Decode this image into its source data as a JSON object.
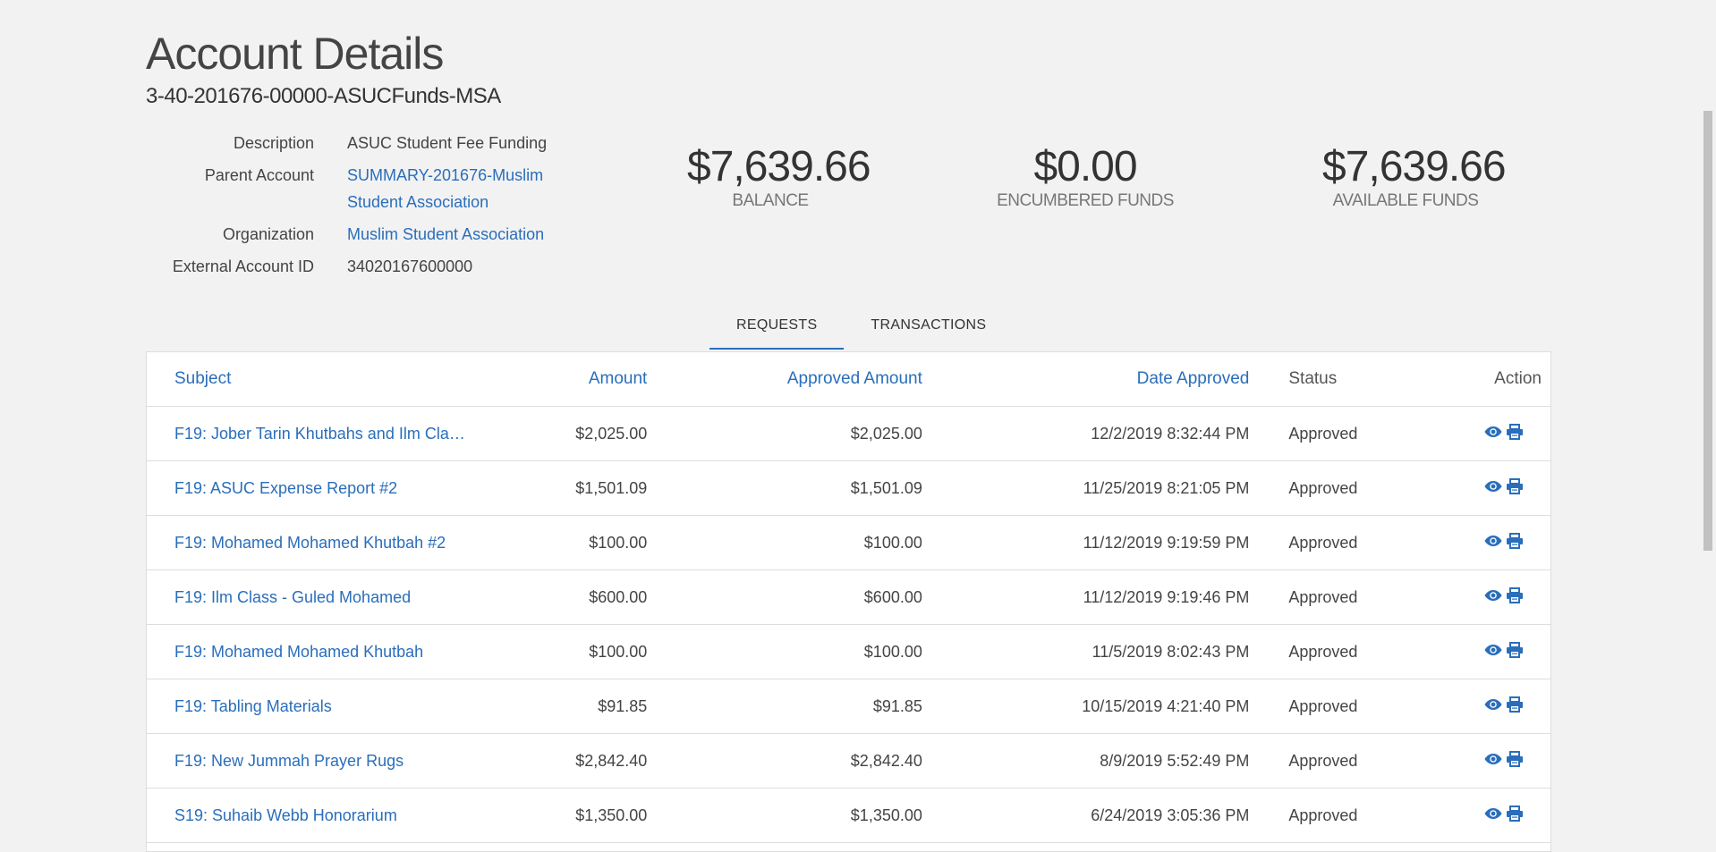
{
  "page": {
    "title": "Account Details",
    "account_code": "3-40-201676-00000-ASUCFunds-MSA"
  },
  "details": {
    "description_label": "Description",
    "description_value": "ASUC Student Fee Funding",
    "parent_label": "Parent Account",
    "parent_value": "SUMMARY-201676-Muslim Student Association",
    "organization_label": "Organization",
    "organization_value": "Muslim Student Association",
    "external_label": "External Account ID",
    "external_value": "34020167600000"
  },
  "stats": {
    "balance_value": "$7,639.66",
    "balance_label": "BALANCE",
    "encumbered_value": "$0.00",
    "encumbered_label": "ENCUMBERED FUNDS",
    "available_value": "$7,639.66",
    "available_label": "AVAILABLE FUNDS"
  },
  "tabs": [
    {
      "label": "REQUESTS",
      "active": true
    },
    {
      "label": "TRANSACTIONS",
      "active": false
    }
  ],
  "table": {
    "headers": {
      "subject": "Subject",
      "amount": "Amount",
      "approved_amount": "Approved Amount",
      "date_approved": "Date Approved",
      "status": "Status",
      "action": "Action"
    },
    "rows": [
      {
        "subject": "F19: Jober Tarin Khutbahs and Ilm Cla…",
        "amount": "$2,025.00",
        "approved": "$2,025.00",
        "date": "12/2/2019 8:32:44 PM",
        "status": "Approved"
      },
      {
        "subject": "F19: ASUC Expense Report #2",
        "amount": "$1,501.09",
        "approved": "$1,501.09",
        "date": "11/25/2019 8:21:05 PM",
        "status": "Approved"
      },
      {
        "subject": "F19: Mohamed Mohamed Khutbah #2",
        "amount": "$100.00",
        "approved": "$100.00",
        "date": "11/12/2019 9:19:59 PM",
        "status": "Approved"
      },
      {
        "subject": "F19: Ilm Class - Guled Mohamed",
        "amount": "$600.00",
        "approved": "$600.00",
        "date": "11/12/2019 9:19:46 PM",
        "status": "Approved"
      },
      {
        "subject": "F19: Mohamed Mohamed Khutbah",
        "amount": "$100.00",
        "approved": "$100.00",
        "date": "11/5/2019 8:02:43 PM",
        "status": "Approved"
      },
      {
        "subject": "F19: Tabling Materials",
        "amount": "$91.85",
        "approved": "$91.85",
        "date": "10/15/2019 4:21:40 PM",
        "status": "Approved"
      },
      {
        "subject": "F19: New Jummah Prayer Rugs",
        "amount": "$2,842.40",
        "approved": "$2,842.40",
        "date": "8/9/2019 5:52:49 PM",
        "status": "Approved"
      },
      {
        "subject": "S19: Suhaib Webb Honorarium",
        "amount": "$1,350.00",
        "approved": "$1,350.00",
        "date": "6/24/2019 3:05:36 PM",
        "status": "Approved"
      }
    ]
  },
  "icons": {
    "view": "eye-icon",
    "print": "printer-icon"
  },
  "colors": {
    "link": "#2a6ebb",
    "background": "#f2f2f2"
  }
}
